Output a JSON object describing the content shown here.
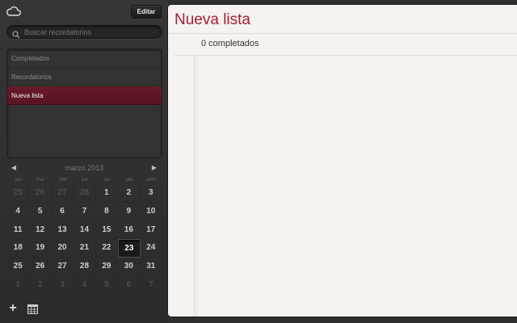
{
  "toolbar": {
    "edit_label": "Editar",
    "cloud_icon": "cloud-icon"
  },
  "search": {
    "placeholder": "Buscar recordatorios",
    "value": ""
  },
  "lists": [
    {
      "label": "Completados",
      "active": false
    },
    {
      "label": "Recordatorios",
      "active": false
    },
    {
      "label": "Nueva lista",
      "active": true
    }
  ],
  "calendar": {
    "month": "marzo 2013",
    "prev_icon": "◀",
    "next_icon": "▶",
    "weekdays": [
      "lun",
      "mar",
      "mié",
      "jue",
      "vie",
      "sáb",
      "dom"
    ],
    "weeks": [
      [
        "25",
        "26",
        "27",
        "28",
        "1",
        "2",
        "3"
      ],
      [
        "4",
        "5",
        "6",
        "7",
        "8",
        "9",
        "10"
      ],
      [
        "11",
        "12",
        "13",
        "14",
        "15",
        "16",
        "17"
      ],
      [
        "18",
        "19",
        "20",
        "21",
        "22",
        "23",
        "24"
      ],
      [
        "25",
        "26",
        "27",
        "28",
        "29",
        "30",
        "31"
      ],
      [
        "1",
        "2",
        "3",
        "4",
        "5",
        "6",
        "7"
      ]
    ],
    "today": "23"
  },
  "bottom": {
    "add_label": "+"
  },
  "main": {
    "title": "Nueva lista",
    "completed_label": "0 completados"
  },
  "colors": {
    "accent": "#a81c35",
    "active_list": "#5e1525",
    "paper": "#f5f2ef"
  }
}
